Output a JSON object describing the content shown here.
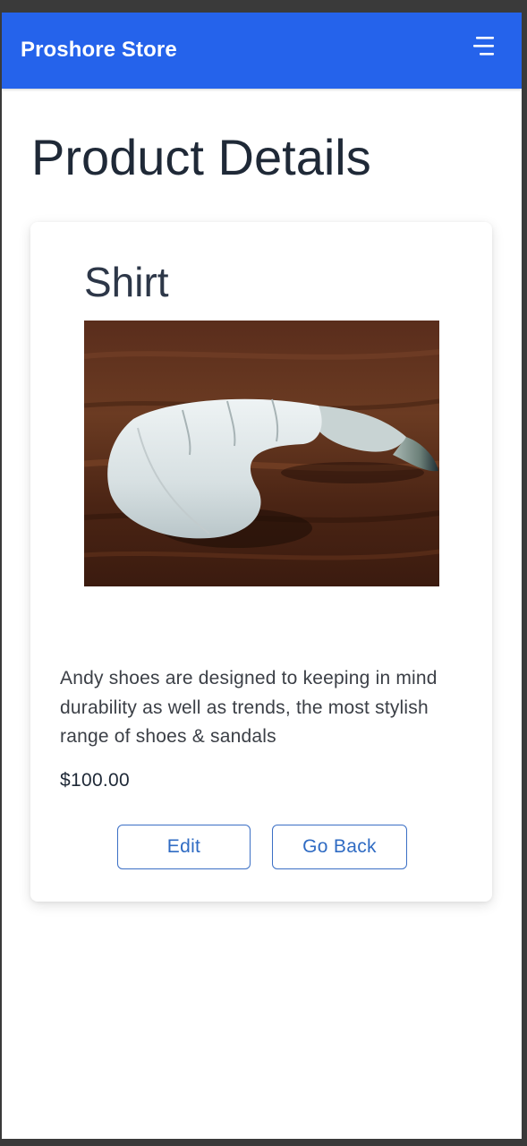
{
  "header": {
    "brand": "Proshore Store",
    "menu_icon": "hamburger-menu-icon",
    "background_color": "#2563eb"
  },
  "page": {
    "title": "Product Details"
  },
  "product": {
    "name": "Shirt",
    "image_alt": "raw shrimp on wooden board",
    "description": "Andy shoes are designed to keeping in mind durability as well as trends, the most stylish range of shoes & sandals",
    "price": "$100.00"
  },
  "actions": {
    "edit_label": "Edit",
    "back_label": "Go Back",
    "accent_color": "#2f6bc3"
  }
}
